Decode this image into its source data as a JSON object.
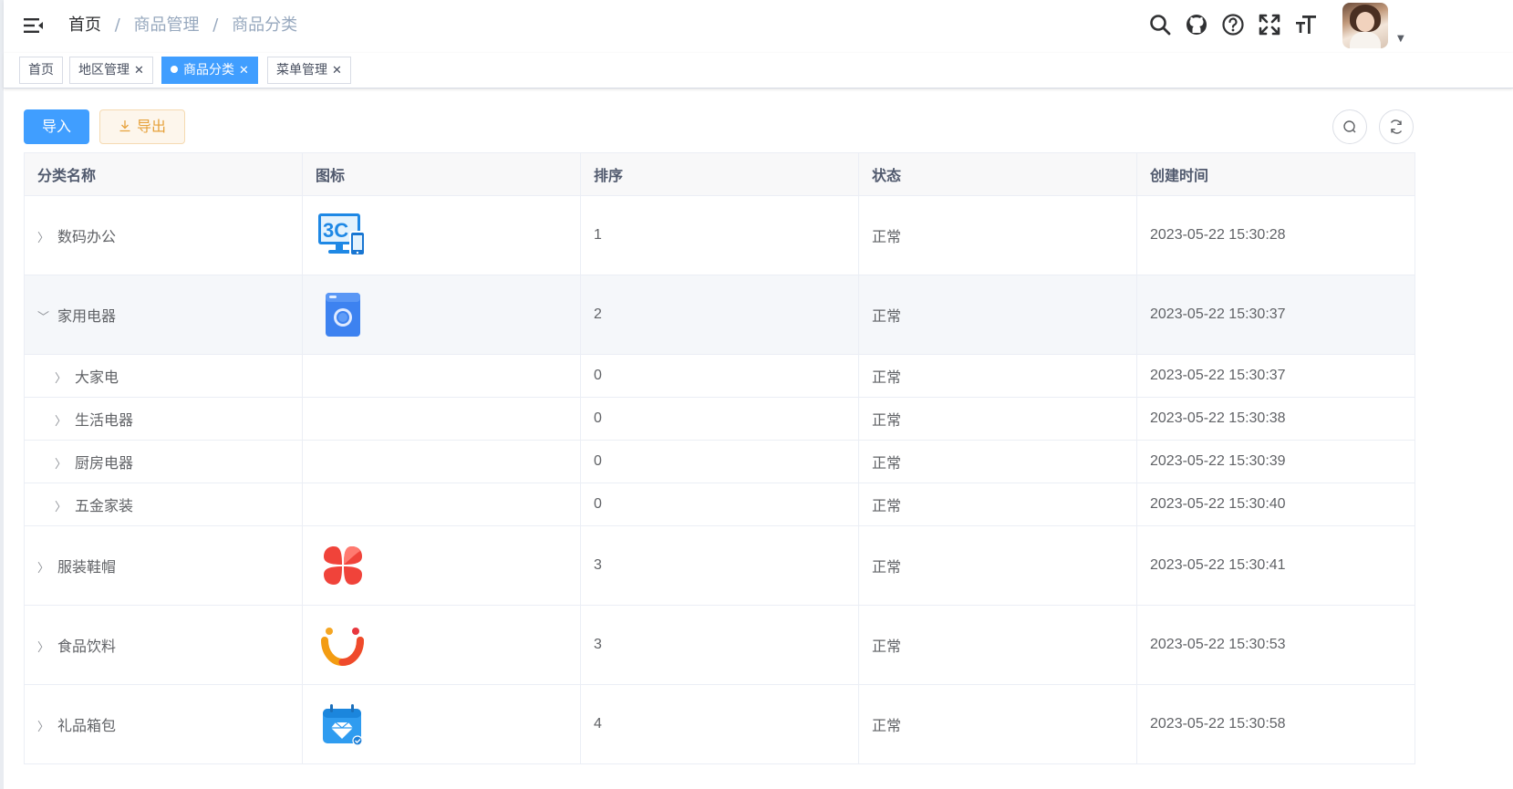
{
  "breadcrumb": {
    "home": "首页",
    "sep": "/",
    "items": [
      "商品管理",
      "商品分类"
    ]
  },
  "header_icons": [
    "search-icon",
    "github-icon",
    "question-icon",
    "fullscreen-icon",
    "font-size-icon"
  ],
  "tags": [
    {
      "label": "首页",
      "closable": false,
      "active": false
    },
    {
      "label": "地区管理",
      "closable": true,
      "active": false
    },
    {
      "label": "商品分类",
      "closable": true,
      "active": true
    },
    {
      "label": "菜单管理",
      "closable": true,
      "active": false
    }
  ],
  "toolbar": {
    "import_label": "导入",
    "export_label": "导出"
  },
  "table": {
    "columns": [
      "分类名称",
      "图标",
      "排序",
      "状态",
      "创建时间"
    ],
    "rows": [
      {
        "name": "数码办公",
        "icon": "3c-icon",
        "sort": "1",
        "status": "正常",
        "created": "2023-05-22 15:30:28",
        "expanded": false,
        "level": 0
      },
      {
        "name": "家用电器",
        "icon": "washing-machine-icon",
        "sort": "2",
        "status": "正常",
        "created": "2023-05-22 15:30:37",
        "expanded": true,
        "level": 0
      },
      {
        "name": "大家电",
        "icon": "",
        "sort": "0",
        "status": "正常",
        "created": "2023-05-22 15:30:37",
        "expanded": false,
        "level": 1
      },
      {
        "name": "生活电器",
        "icon": "",
        "sort": "0",
        "status": "正常",
        "created": "2023-05-22 15:30:38",
        "expanded": false,
        "level": 1
      },
      {
        "name": "厨房电器",
        "icon": "",
        "sort": "0",
        "status": "正常",
        "created": "2023-05-22 15:30:39",
        "expanded": false,
        "level": 1
      },
      {
        "name": "五金家装",
        "icon": "",
        "sort": "0",
        "status": "正常",
        "created": "2023-05-22 15:30:40",
        "expanded": false,
        "level": 1
      },
      {
        "name": "服装鞋帽",
        "icon": "clover-icon",
        "sort": "3",
        "status": "正常",
        "created": "2023-05-22 15:30:41",
        "expanded": false,
        "level": 0
      },
      {
        "name": "食品饮料",
        "icon": "smile-icon",
        "sort": "3",
        "status": "正常",
        "created": "2023-05-22 15:30:53",
        "expanded": false,
        "level": 0
      },
      {
        "name": "礼品箱包",
        "icon": "gift-calendar-icon",
        "sort": "4",
        "status": "正常",
        "created": "2023-05-22 15:30:58",
        "expanded": false,
        "level": 0
      }
    ]
  },
  "colors": {
    "primary": "#409eff",
    "warning": "#e6a23c",
    "text": "#606266",
    "header_bg": "#f8f8f9"
  }
}
